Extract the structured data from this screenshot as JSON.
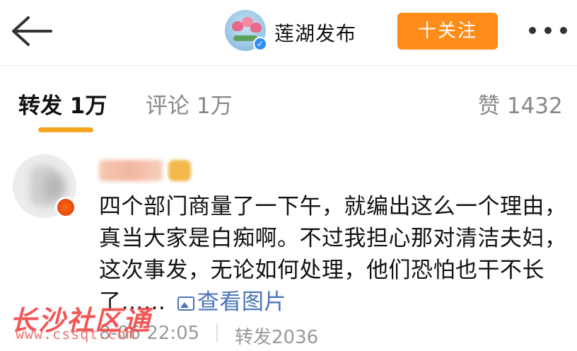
{
  "header": {
    "account_name": "莲湖发布",
    "follow_label": "十关注",
    "verified_mark": "✓"
  },
  "tabs": [
    {
      "label": "转发 1万",
      "active": true
    },
    {
      "label": "评论 1万",
      "active": false
    },
    {
      "label": "赞 1432",
      "active": false
    }
  ],
  "post": {
    "text": "四个部门商量了一下午，就编出这么一个理由，真当大家是白痴啊。不过我担心那对清洁夫妇，这次事发，无论如何处理，他们恐怕也干不长了……",
    "view_image_label": "查看图片",
    "time": "8-06 22:05",
    "repost_label": "转发2036"
  },
  "watermark": {
    "name": "长沙社区通",
    "url": "www.cssqt.com"
  },
  "colors": {
    "accent_orange": "#ff8c19",
    "tab_indicator": "#f5a623",
    "link_blue": "#4a74b8",
    "watermark_red": "#f04a4a"
  }
}
